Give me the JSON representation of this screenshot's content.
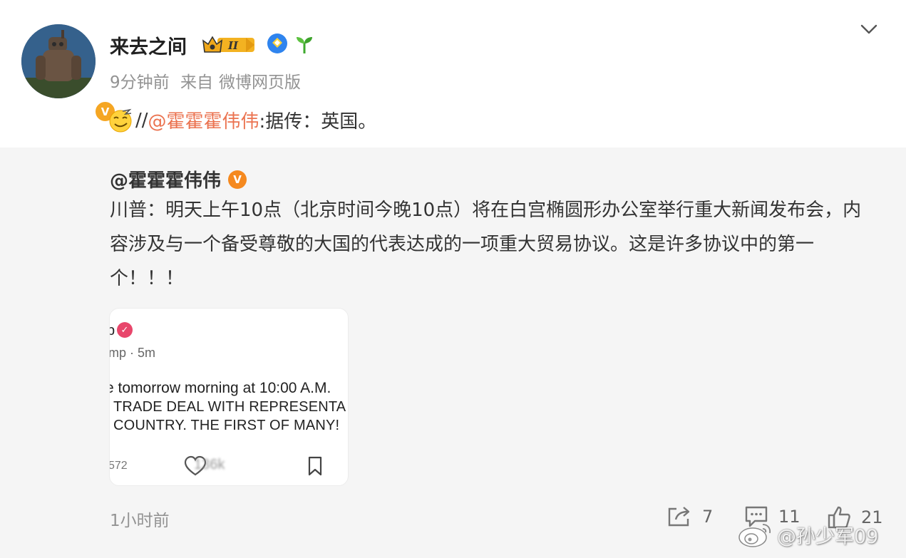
{
  "post": {
    "username": "来去之间",
    "rank_badge": "II",
    "time_ago": "9分钟前",
    "source_prefix": "来自",
    "source": "微博网页版",
    "repost_separator": "//",
    "repost_mention": "@霍霍霍伟伟",
    "repost_text": ":据传：英国。"
  },
  "original": {
    "user": "@霍霍霍伟伟",
    "text": "川普：明天上午10点（北京时间今晚10点）将在白宫椭圆形办公室举行重大新闻发布会，内容涉及与一个备受尊敬的大国的代表达成的一项重大贸易协议。这是许多协议中的第一个！！！",
    "image": {
      "line1": "p",
      "line2": "mp · 5m",
      "line3": "e tomorrow morning at 10:00 A.M.",
      "line4": "TRADE DEAL WITH REPRESENTA",
      "line5": "COUNTRY. THE FIRST OF MANY!",
      "reply_count": "572",
      "like_count": "136k"
    },
    "time": "1小时前",
    "shares": "7",
    "comments": "11",
    "likes": "21"
  },
  "watermark": "@孙少军09",
  "icons": [
    "chevron-down-icon",
    "share-icon",
    "comment-icon",
    "like-icon",
    "weibo-logo-icon",
    "verified-icon",
    "sprout-icon",
    "crown-icon"
  ],
  "colors": {
    "mention": "#eb7350",
    "verified": "#f5891f",
    "retweet_bg": "#f5f5f5"
  }
}
